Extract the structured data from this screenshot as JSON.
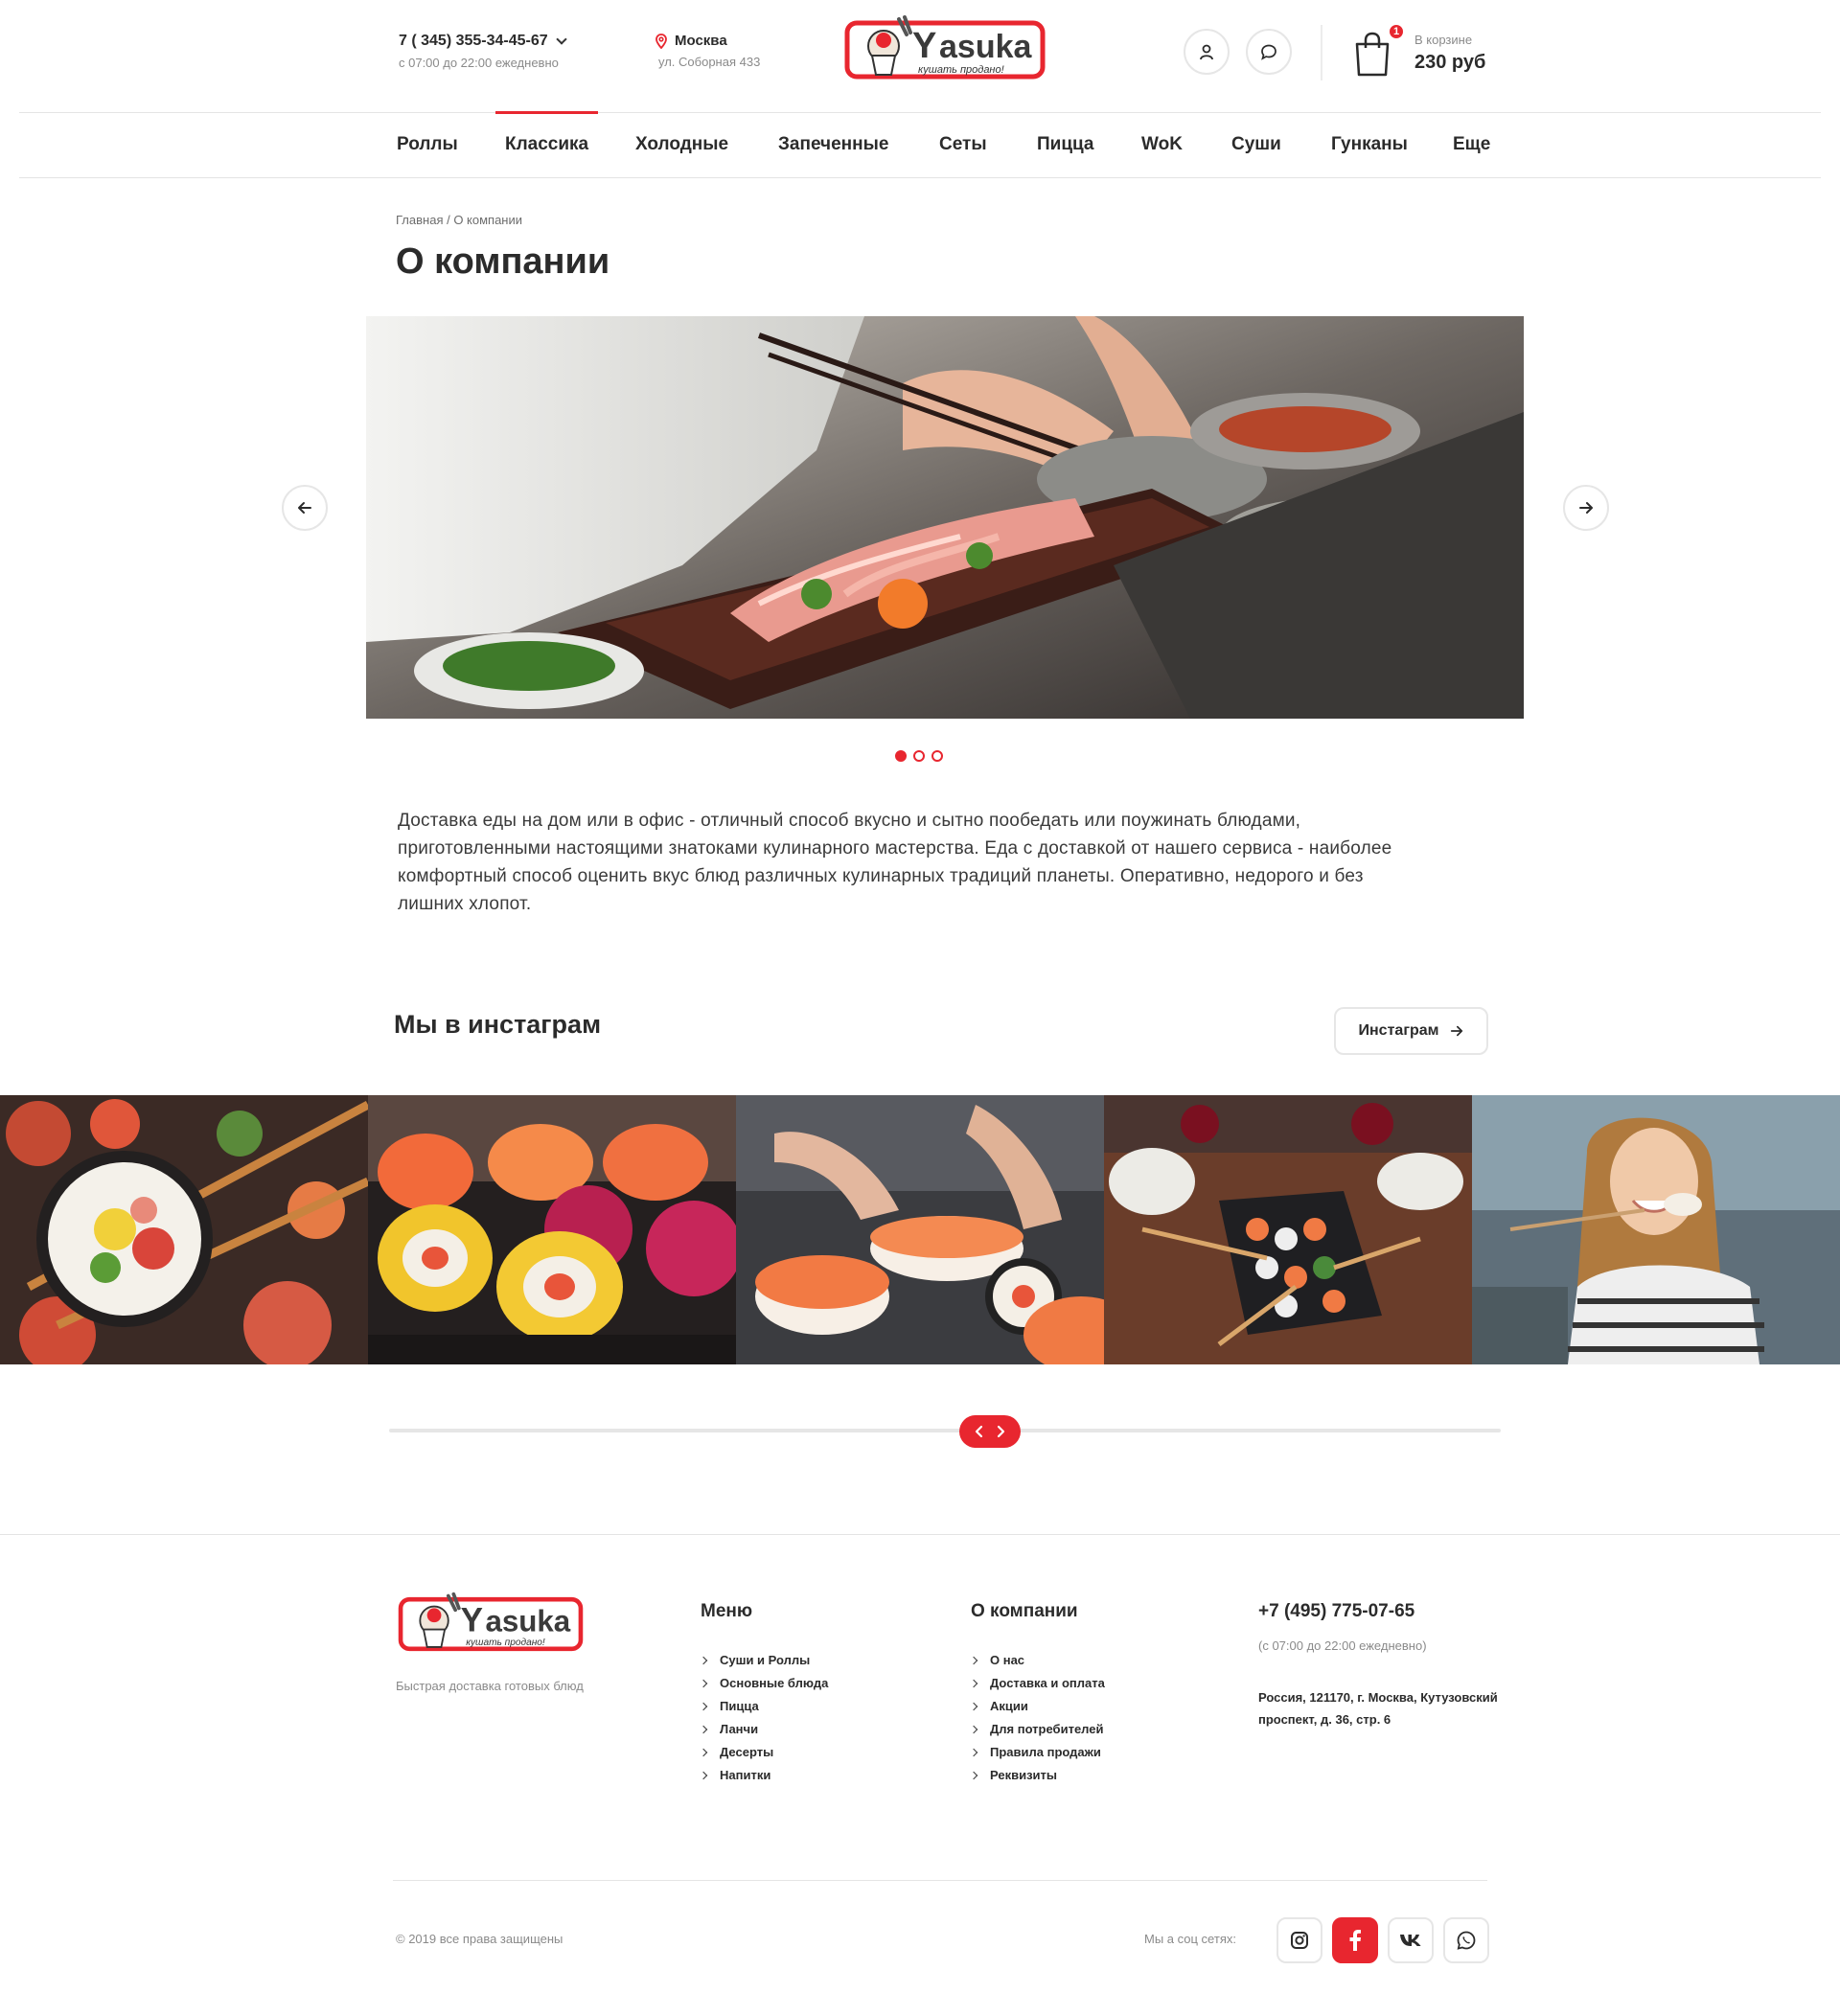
{
  "header": {
    "phone": "7 ( 345) 355-34-45-67",
    "hours": "с 07:00 до 22:00 ежедневно",
    "city": "Москва",
    "street": "ул. Соборная 433",
    "logo_text": "asuka",
    "logo_tagline": "кушать продано!",
    "cart_count": "1",
    "cart_label": "В корзине",
    "cart_sum": "230 руб"
  },
  "nav": {
    "items": [
      {
        "label": "Роллы"
      },
      {
        "label": "Классика",
        "active": true
      },
      {
        "label": "Холодные"
      },
      {
        "label": "Запеченные"
      },
      {
        "label": "Сеты"
      },
      {
        "label": "Пицца"
      },
      {
        "label": "WoK"
      },
      {
        "label": "Суши"
      },
      {
        "label": "Гунканы"
      },
      {
        "label": "Еще"
      }
    ]
  },
  "breadcrumb": "Главная / О компании",
  "page_title": "О компании",
  "slider": {
    "active_index": 0,
    "slides_count": 3
  },
  "about_text": "Доставка еды на дом или в офис - отличный способ вкусно и сытно пообедать или поужинать блюдами, приготовленными настоящими знатоками кулинарного мастерства. Еда с доставкой от нашего сервиса - наиболее комфортный способ оценить вкус блюд различных кулинарных традиций планеты. Оперативно, недорого и без лишних хлопот.",
  "instagram": {
    "title": "Мы в инстаграм",
    "button_label": "Инстаграм"
  },
  "footer": {
    "tagline": "Быстрая доставка готовых блюд",
    "menu_title": "Меню",
    "menu_items": [
      "Суши и Роллы",
      "Основные блюда",
      "Пицца",
      "Ланчи",
      "Десерты",
      "Напитки"
    ],
    "company_title": "О компании",
    "company_items": [
      "О нас",
      "Доставка и оплата",
      "Акции",
      "Для потребителей",
      "Правила продажи",
      "Реквизиты"
    ],
    "phone": "+7 (495) 775-07-65",
    "hours": "(с 07:00 до 22:00 ежедневно)",
    "address": "Россия, 121170, г. Москва, Кутузовский проспект, д. 36, стр. 6",
    "copyright": "© 2019 все права защищены",
    "social_label": "Мы а соц сетях:",
    "social": [
      "instagram-icon",
      "facebook-icon",
      "vk-icon",
      "whatsapp-icon"
    ]
  },
  "colors": {
    "accent": "#e8262f",
    "text": "#2b2b2b",
    "muted": "#8a8a8a"
  }
}
